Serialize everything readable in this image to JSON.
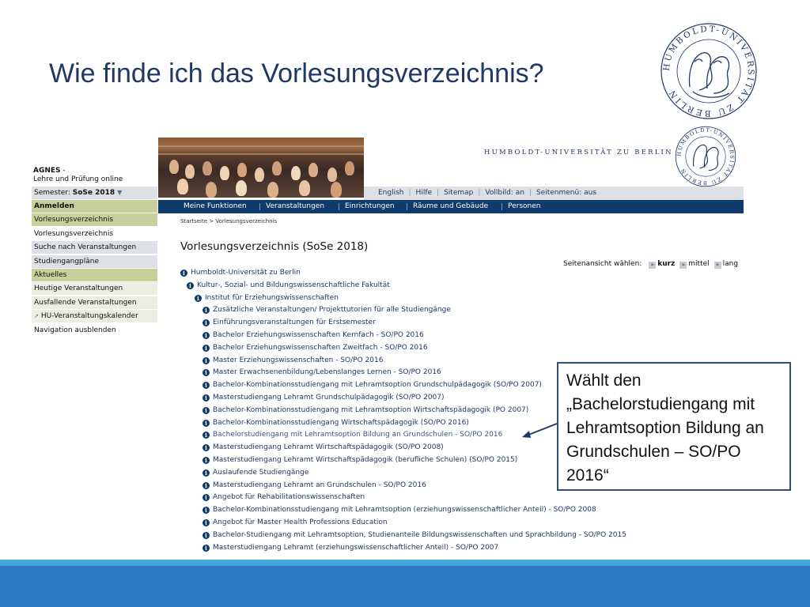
{
  "slide": {
    "title": "Wie finde ich das Vorlesungsverzeichnis?"
  },
  "logo": {
    "seal_text": "HUMBOLDT-UNIVERSITÄT ZU BERLIN",
    "wordmark": "HUMBOLDT-UNIVERSITÄT ZU BERLIN",
    "colors": {
      "navy": "#1f3864"
    }
  },
  "agnes": {
    "brand_name": "AGNES",
    "brand_dash": " -",
    "brand_sub": "Lehre und Prüfung online",
    "semester_label": "Semester: ",
    "semester_value": "SoSe 2018",
    "semester_arrow": "▼",
    "sidebar": [
      {
        "label": "Anmelden",
        "style": "olive",
        "bold": true
      },
      {
        "label": "Vorlesungsverzeichnis",
        "style": "olive",
        "bold": false
      },
      {
        "label": "Vorlesungsverzeichnis",
        "style": "white",
        "bold": false
      },
      {
        "label": "Suche nach Veranstaltungen",
        "style": "gray",
        "bold": false
      },
      {
        "label": "Studiengangpläne",
        "style": "gray",
        "bold": false
      },
      {
        "label": "Aktuelles",
        "style": "olive",
        "bold": false
      },
      {
        "label": "Heutige Veranstaltungen",
        "style": "light",
        "bold": false
      },
      {
        "label": "Ausfallende Veranstaltungen",
        "style": "light",
        "bold": false
      },
      {
        "label": "HU-Veranstaltungskalender",
        "style": "light",
        "bold": false,
        "external": true
      },
      {
        "label": "Navigation ausblenden",
        "style": "white",
        "bold": false
      }
    ],
    "topbar": [
      "English",
      "Hilfe",
      "Sitemap",
      "Vollbild: an",
      "Seitenmenü: aus"
    ],
    "nav": [
      "Meine Funktionen",
      "Veranstaltungen",
      "Einrichtungen",
      "Räume und Gebäude",
      "Personen"
    ],
    "breadcrumb": "Startseite > Vorlesungsverzeichnis",
    "content_title": "Vorlesungsverzeichnis (SoSe 2018)",
    "view_label": "Seitenansicht wählen:",
    "view_options": [
      "kurz",
      "mittel",
      "lang"
    ],
    "view_selected": "kurz",
    "tree": [
      {
        "label": "Humboldt-Universität zu Berlin",
        "level": 0
      },
      {
        "label": "Kultur-, Sozial- und Bildungswissenschaftliche Fakultät",
        "level": 1
      },
      {
        "label": "Institut für Erziehungswissenschaften",
        "level": 2
      },
      {
        "label": "Zusätzliche Veranstaltungen/ Projekttutorien für alle Studiengänge",
        "level": 3
      },
      {
        "label": "Einführungsveranstaltungen für Erstsemester",
        "level": 3
      },
      {
        "label": "Bachelor Erziehungswissenschaften Kernfach - SO/PO 2016",
        "level": 3
      },
      {
        "label": "Bachelor Erziehungswissenschaften Zweitfach - SO/PO 2016",
        "level": 3
      },
      {
        "label": "Master Erziehungswissenschaften - SO/PO 2016",
        "level": 3
      },
      {
        "label": "Master Erwachsenenbildung/Lebenslanges Lernen - SO/PO 2016",
        "level": 3
      },
      {
        "label": "Bachelor-Kombinationsstudiengang mit Lehramtsoption Grundschulpädagogik (SO/PO 2007)",
        "level": 3
      },
      {
        "label": "Masterstudiengang Lehramt Grundschulpädagogik (SO/PO 2007)",
        "level": 3
      },
      {
        "label": "Bachelor-Kombinationsstudiengang mit Lehramtsoption Wirtschaftspädagogik (PO 2007)",
        "level": 3
      },
      {
        "label": "Bachelor-Kombinationsstudiengang Wirtschaftspädagogik (SO/PO 2016)",
        "level": 3
      },
      {
        "label": "Bachelorstudiengang mit Lehramtsoption Bildung an Grundschulen - SO/PO 2016",
        "level": 3,
        "highlight": true
      },
      {
        "label": "Masterstudiengang Lehramt Wirtschaftspädagogik (SO/PO 2008)",
        "level": 3
      },
      {
        "label": "Masterstudiengang Lehramt Wirtschaftspädagogik (berufliche Schulen) (SO/PO 2015)",
        "level": 3
      },
      {
        "label": "Auslaufende Studiengänge",
        "level": 3
      },
      {
        "label": "Masterstudiengang Lehramt an Grundschulen - SO/PO 2016",
        "level": 3
      },
      {
        "label": "Angebot für Rehabilitationswissenschaften",
        "level": 3
      },
      {
        "label": "Bachelor-Kombinationsstudiengang mit Lehramtsoption (erziehungswissenschaftlicher Anteil) - SO/PO 2008",
        "level": 3
      },
      {
        "label": "Angebot für Master Health Professions Education",
        "level": 3
      },
      {
        "label": "Bachelor-Studiengang mit Lehramtsoption, Studienanteile Bildungswissenschaften und Sprachbildung - SO/PO 2015",
        "level": 3
      },
      {
        "label": "Masterstudiengang Lehramt (erziehungswissenschaftlicher Anteil) - SO/PO 2007",
        "level": 3
      }
    ],
    "colors": {
      "nav_bg": "#0e3a6c",
      "topbar_bg": "#dde1e6",
      "olive": "#c9cf9b"
    }
  },
  "callout": {
    "line1": "Wählt den",
    "line2": "„Bachelorstudiengang mit",
    "line3": "Lehramtsoption Bildung an",
    "line4": "Grundschulen – SO/PO",
    "line5": "2016“"
  },
  "footer": {
    "colors": {
      "thin": "#41a9dc",
      "band": "#2d79bf"
    }
  }
}
